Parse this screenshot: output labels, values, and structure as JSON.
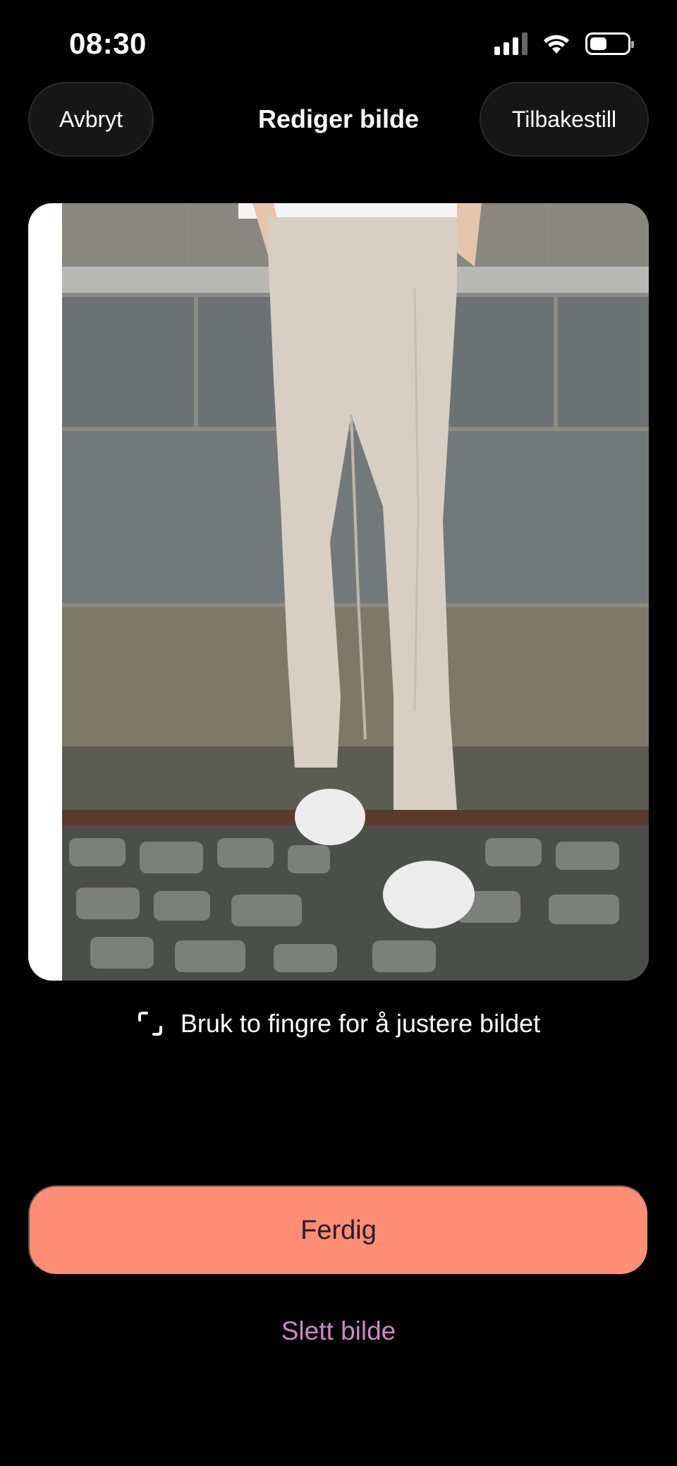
{
  "status_bar": {
    "time": "08:30",
    "icons": [
      "cellular-signal-icon",
      "wifi-icon",
      "battery-icon"
    ]
  },
  "header": {
    "cancel_label": "Avbryt",
    "title": "Rediger bilde",
    "reset_label": "Tilbakestill"
  },
  "editor": {
    "image_subject": "photo",
    "hint_icon": "crop-icon",
    "hint_text": "Bruk to fingre for å justere bildet"
  },
  "actions": {
    "done_label": "Ferdig",
    "delete_label": "Slett bilde"
  },
  "colors": {
    "background": "#000000",
    "primary_button": "#ff8e74",
    "delete_link": "#c98ac4"
  }
}
